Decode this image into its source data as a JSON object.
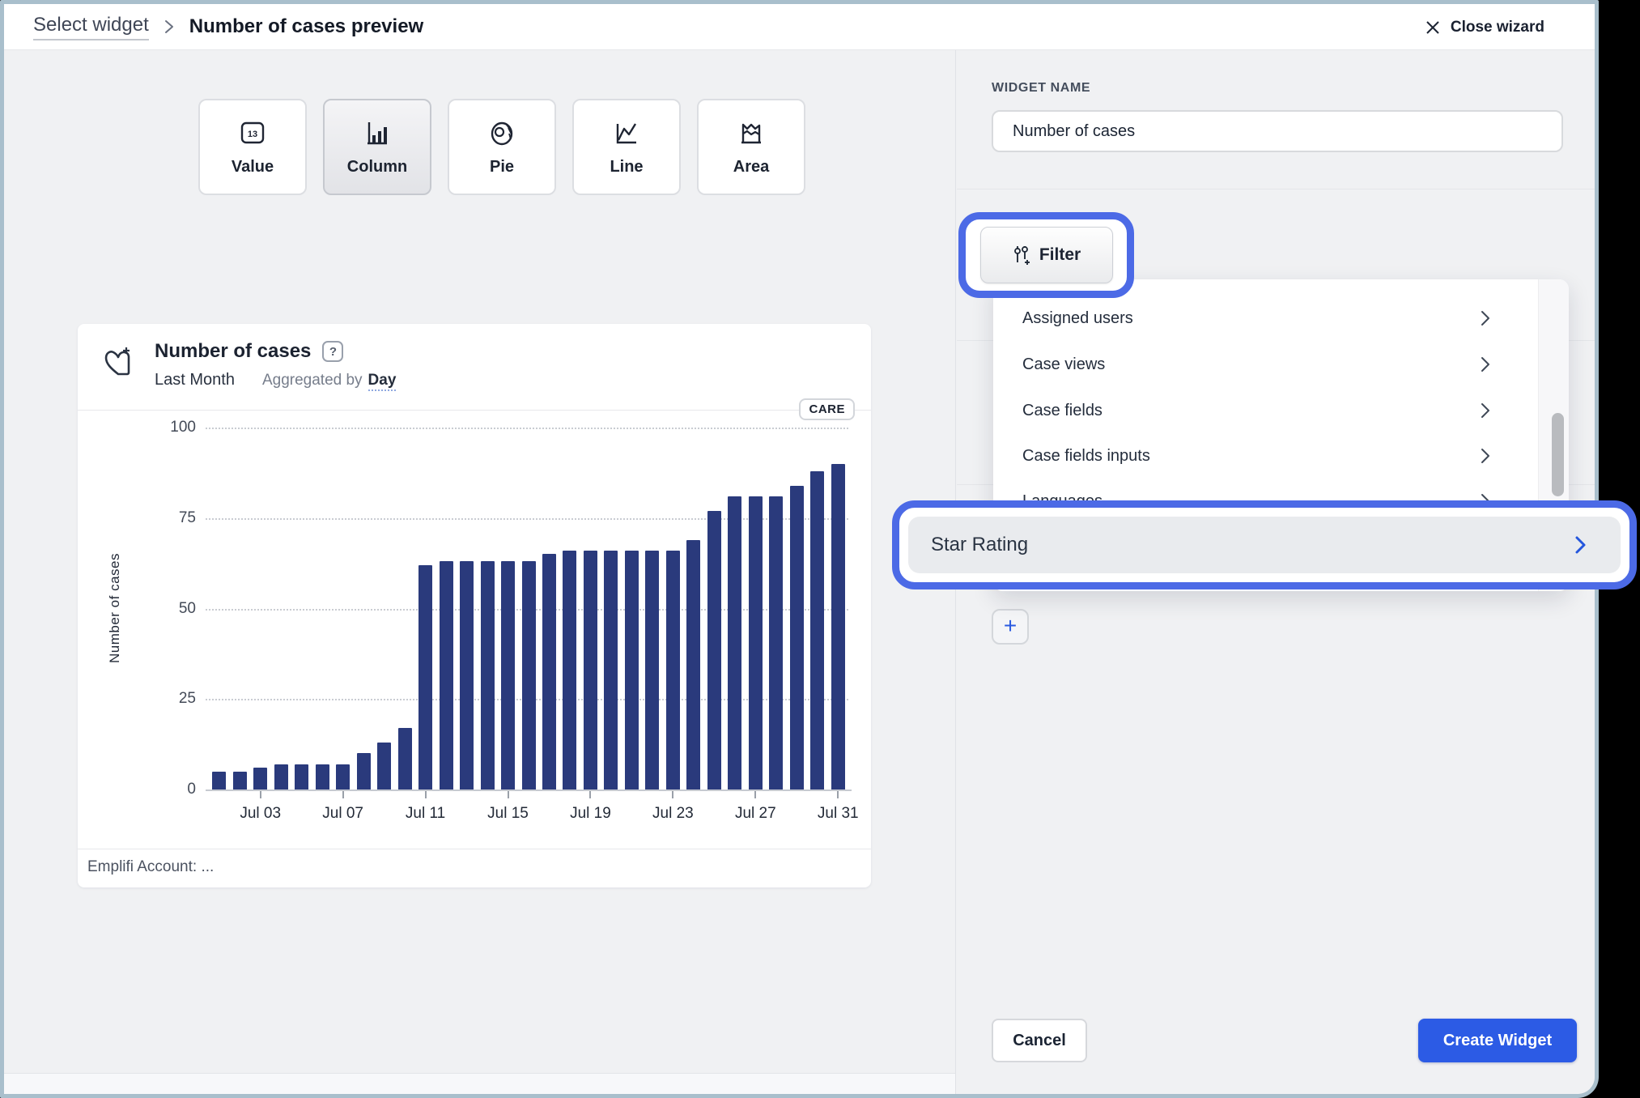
{
  "breadcrumb": {
    "link": "Select widget",
    "current": "Number of cases preview"
  },
  "window": {
    "close_label": "Close wizard"
  },
  "widget_types": {
    "items": [
      {
        "label": "Value",
        "icon_text": "13",
        "selected": false
      },
      {
        "label": "Column",
        "selected": true
      },
      {
        "label": "Pie",
        "selected": false
      },
      {
        "label": "Line",
        "selected": false
      },
      {
        "label": "Area",
        "selected": false
      }
    ]
  },
  "preview_card": {
    "title": "Number of cases",
    "help_icon": "?",
    "period": "Last Month",
    "aggregation_prefix": "Aggregated by",
    "aggregation_value": "Day",
    "badge": "CARE",
    "footer": "Emplifi Account: ..."
  },
  "chart_data": {
    "type": "bar",
    "title": "Number of cases",
    "ylabel": "Number of cases",
    "ylim": [
      0,
      100
    ],
    "yticks": [
      0,
      25,
      50,
      75,
      100
    ],
    "grid": "horizontal-dotted",
    "bar_color": "#2a3a7c",
    "x": [
      "Jul 01",
      "Jul 02",
      "Jul 03",
      "Jul 04",
      "Jul 05",
      "Jul 06",
      "Jul 07",
      "Jul 08",
      "Jul 09",
      "Jul 10",
      "Jul 11",
      "Jul 12",
      "Jul 13",
      "Jul 14",
      "Jul 15",
      "Jul 16",
      "Jul 17",
      "Jul 18",
      "Jul 19",
      "Jul 20",
      "Jul 21",
      "Jul 22",
      "Jul 23",
      "Jul 24",
      "Jul 25",
      "Jul 26",
      "Jul 27",
      "Jul 28",
      "Jul 29",
      "Jul 30",
      "Jul 31"
    ],
    "values": [
      5,
      5,
      6,
      7,
      7,
      7,
      7,
      10,
      13,
      17,
      62,
      63,
      63,
      63,
      63,
      63,
      65,
      66,
      66,
      66,
      66,
      66,
      66,
      69,
      77,
      81,
      81,
      81,
      84,
      88,
      90
    ],
    "xtick_labels": [
      "Jul 03",
      "Jul 07",
      "Jul 11",
      "Jul 15",
      "Jul 19",
      "Jul 23",
      "Jul 27",
      "Jul 31"
    ],
    "xtick_indices": [
      2,
      6,
      10,
      14,
      18,
      22,
      26,
      30
    ]
  },
  "sidebar": {
    "widget_name_label": "WIDGET NAME",
    "widget_name_value": "Number of cases",
    "filter_button_label": "Filter",
    "filter_menu": {
      "items": [
        {
          "label": "Assigned users"
        },
        {
          "label": "Case views"
        },
        {
          "label": "Case fields"
        },
        {
          "label": "Case fields inputs"
        },
        {
          "label": "Languages",
          "partially_hidden": true
        }
      ]
    },
    "highlighted_item": {
      "label": "Star Rating"
    },
    "add_button_label": "+",
    "cancel_label": "Cancel",
    "create_label": "Create Widget"
  },
  "colors": {
    "annotation_blue": "#4c6ae6",
    "primary_button_blue": "#2c5be5",
    "bar_navy": "#2a3a7c"
  }
}
